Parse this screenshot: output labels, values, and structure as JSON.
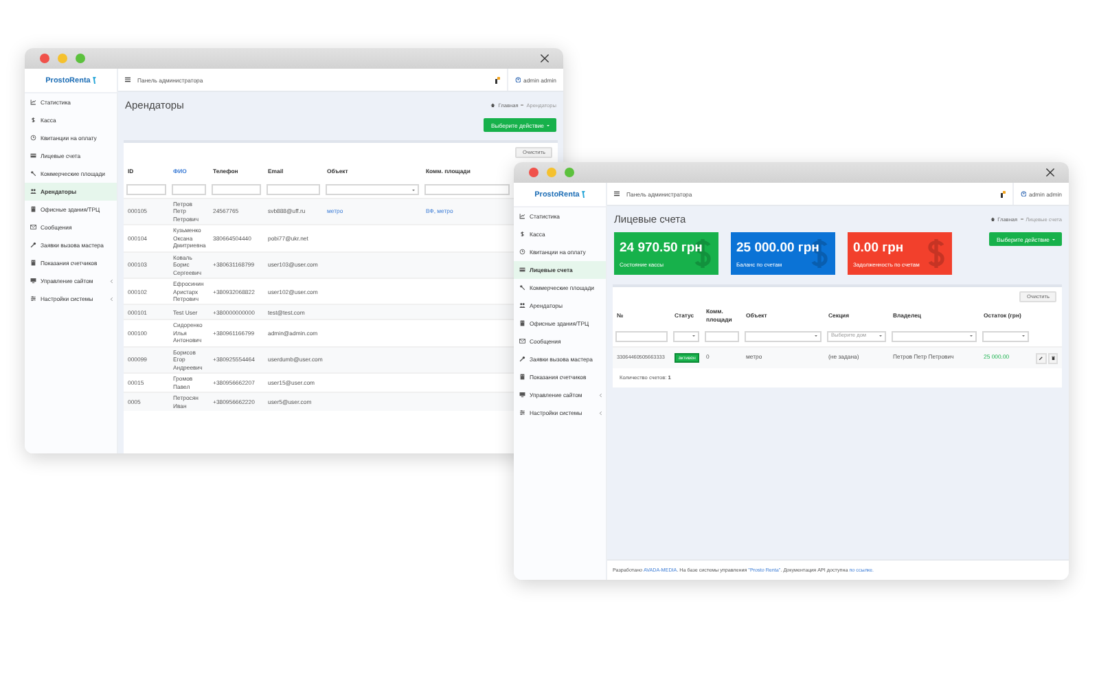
{
  "tenants_window": {
    "logo": "ProstoRenta",
    "header_title": "Панель администратора",
    "notifications": true,
    "user": "admin admin",
    "sidebar": [
      {
        "label": "Статистика",
        "selected": false,
        "has_submenu": false
      },
      {
        "label": "Касса",
        "selected": false,
        "has_submenu": false
      },
      {
        "label": "Квитанции на оплату",
        "selected": false,
        "has_submenu": false
      },
      {
        "label": "Лицевые счета",
        "selected": false,
        "has_submenu": false
      },
      {
        "label": "Коммерческие площади",
        "selected": false,
        "has_submenu": false
      },
      {
        "label": "Арендаторы",
        "selected": true,
        "has_submenu": false
      },
      {
        "label": "Офисные здания/ТРЦ",
        "selected": false,
        "has_submenu": false
      },
      {
        "label": "Сообщения",
        "selected": false,
        "has_submenu": false
      },
      {
        "label": "Заявки вызова мастера",
        "selected": false,
        "has_submenu": false
      },
      {
        "label": "Показания счетчиков",
        "selected": false,
        "has_submenu": false
      },
      {
        "label": "Управление сайтом",
        "selected": false,
        "has_submenu": true
      },
      {
        "label": "Настройки системы",
        "selected": false,
        "has_submenu": true
      }
    ],
    "page_title": "Арендаторы",
    "breadcrumbs": [
      "Главная",
      "Арендаторы"
    ],
    "action_button": "Выберите действие",
    "clear_button": "Очистить",
    "columns": [
      {
        "label": "ID",
        "link": false,
        "kind": "input"
      },
      {
        "label": "ФИО",
        "link": true,
        "kind": "input"
      },
      {
        "label": "Телефон",
        "link": false,
        "kind": "input"
      },
      {
        "label": "Email",
        "link": false,
        "kind": "input"
      },
      {
        "label": "Объект",
        "link": false,
        "kind": "select"
      },
      {
        "label": "Комм. площади",
        "link": false,
        "kind": "input"
      }
    ],
    "rows": [
      {
        "cells": [
          "000105",
          "Петров Петр Петрович",
          "24567765",
          "svb888@uff.ru",
          "метро",
          "ВФ, метро"
        ]
      },
      {
        "cells": [
          "000104",
          "Кузьменко Оксана Дмитриевна",
          "380664504440",
          "pobi77@ukr.net",
          "",
          ""
        ]
      },
      {
        "cells": [
          "000103",
          "Коваль Борис Сергеевич",
          "+380631168799",
          "user103@user.com",
          "",
          ""
        ]
      },
      {
        "cells": [
          "000102",
          "Ефросинин Аристарх Петрович",
          "+380932068822",
          "user102@user.com",
          "",
          ""
        ]
      },
      {
        "cells": [
          "000101",
          "Test User",
          "+380000000000",
          "test@test.com",
          "",
          ""
        ]
      },
      {
        "cells": [
          "000100",
          "Сидоренко Илья Антонович",
          "+380961166799",
          "admin@admin.com",
          "",
          ""
        ]
      },
      {
        "cells": [
          "000099",
          "Борисов Егор Андреевич",
          "+380925554464",
          "userdumb@user.com",
          "",
          ""
        ]
      },
      {
        "cells": [
          "00015",
          "Громов Павел",
          "+380956662207",
          "user15@user.com",
          "",
          ""
        ]
      },
      {
        "cells": [
          "0005",
          "Петросян Иван",
          "+380956662220",
          "user5@user.com",
          "",
          ""
        ]
      }
    ]
  },
  "accounts_window": {
    "logo": "ProstoRenta",
    "header_title": "Панель администратора",
    "notifications": true,
    "user": "admin admin",
    "sidebar": [
      {
        "label": "Статистика",
        "selected": false,
        "has_submenu": false
      },
      {
        "label": "Касса",
        "selected": false,
        "has_submenu": false
      },
      {
        "label": "Квитанции на оплату",
        "selected": false,
        "has_submenu": false
      },
      {
        "label": "Лицевые счета",
        "selected": true,
        "has_submenu": false
      },
      {
        "label": "Коммерческие площади",
        "selected": false,
        "has_submenu": false
      },
      {
        "label": "Арендаторы",
        "selected": false,
        "has_submenu": false
      },
      {
        "label": "Офисные здания/ТРЦ",
        "selected": false,
        "has_submenu": false
      },
      {
        "label": "Сообщения",
        "selected": false,
        "has_submenu": false
      },
      {
        "label": "Заявки вызова мастера",
        "selected": false,
        "has_submenu": false
      },
      {
        "label": "Показания счетчиков",
        "selected": false,
        "has_submenu": false
      },
      {
        "label": "Управление сайтом",
        "selected": false,
        "has_submenu": true
      },
      {
        "label": "Настройки системы",
        "selected": false,
        "has_submenu": true
      }
    ],
    "page_title": "Лицевые счета",
    "breadcrumbs": [
      "Главная",
      "Лицевые счета"
    ],
    "stat_cards": [
      {
        "amount": "24 970.50 грн",
        "caption": "Состояние кассы",
        "color": "#17b14b"
      },
      {
        "amount": "25 000.00 грн",
        "caption": "Баланс по счетам",
        "color": "#0b73d6"
      },
      {
        "amount": "0.00 грн",
        "caption": "Задолженность по счетам",
        "color": "#f2402c"
      }
    ],
    "action_button": "Выберите действие",
    "clear_button": "Очистить",
    "columns": [
      {
        "label": "№",
        "kind": "input"
      },
      {
        "label": "Статус",
        "kind": "select"
      },
      {
        "label": "Комм. площади",
        "kind": "input"
      },
      {
        "label": "Объект",
        "kind": "select"
      },
      {
        "label": "Секция",
        "kind": "select",
        "placeholder": "Выберите дом"
      },
      {
        "label": "Владелец",
        "kind": "select"
      },
      {
        "label": "Остаток (грн)",
        "kind": "select"
      }
    ],
    "rows": [
      {
        "number": "33064460505663333",
        "status": "активен",
        "active": true,
        "area": "0",
        "object": "метро",
        "section": "(не задана)",
        "owner": "Петров Петр Петрович",
        "balance": "25 000.00"
      }
    ],
    "count_label": "Количество счетов:",
    "count": "1",
    "footer": [
      {
        "text": "Разработано ",
        "link": false
      },
      {
        "text": "AVADA-MEDIA",
        "link": true
      },
      {
        "text": ". На базе системы управления ",
        "link": false
      },
      {
        "text": "\"Prosto Renta\"",
        "link": true
      },
      {
        "text": ". Документация API доступна ",
        "link": false
      },
      {
        "text": "по ссылке.",
        "link": true
      }
    ]
  }
}
